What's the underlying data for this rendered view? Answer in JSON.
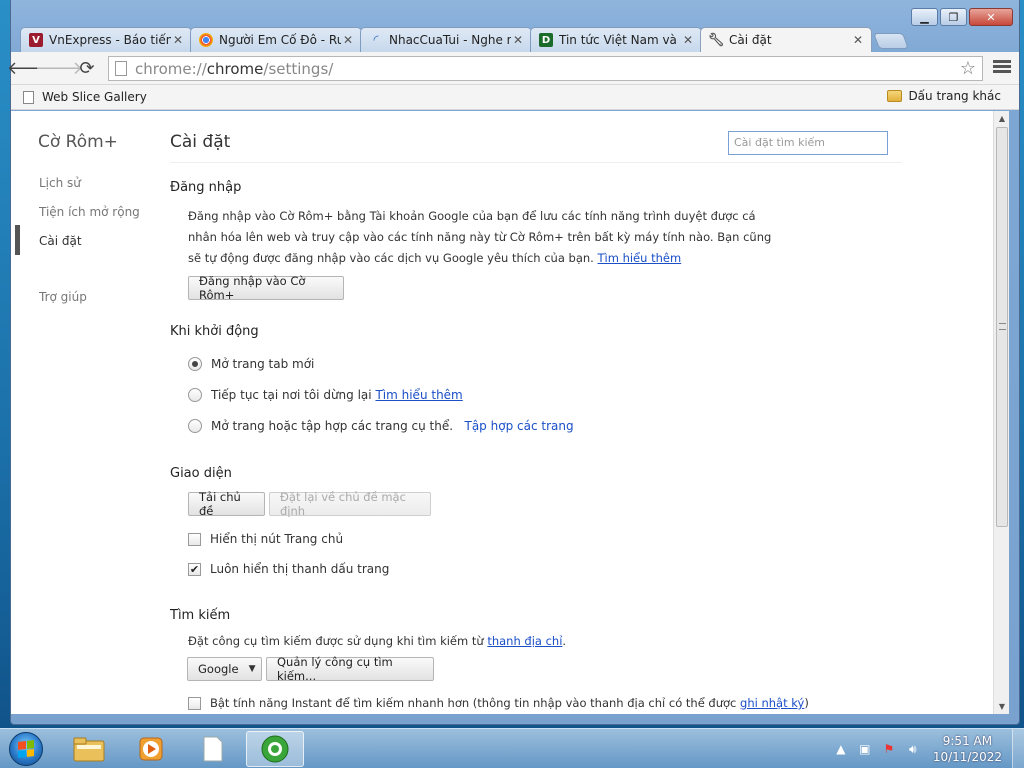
{
  "tabs": [
    {
      "title": "VnExpress - Báo tiếng Việt",
      "favicon_color": "#9b1c2e",
      "favicon_glyph": "V"
    },
    {
      "title": "Người Em Cố Đô - Rum",
      "favicon_color": "#4285f4",
      "favicon_glyph": "●"
    },
    {
      "title": "NhacCuaTui - Nghe nhạc",
      "favicon_color": "#2b6cc7",
      "favicon_glyph": "◜"
    },
    {
      "title": "Tin tức Việt Nam và quốc tế",
      "favicon_color": "#1b6b2a",
      "favicon_glyph": "D"
    },
    {
      "title": "Cài đặt",
      "favicon_color": "#555555",
      "favicon_glyph": "🔧"
    }
  ],
  "omnibox": {
    "scheme": "chrome://",
    "host": "chrome",
    "path": "/settings/"
  },
  "bookmarks": {
    "item": "Web Slice Gallery",
    "other": "Dấu trang khác"
  },
  "sidebar": {
    "brand": "Cờ Rôm+",
    "items": [
      "Lịch sử",
      "Tiện ích mở rộng",
      "Cài đặt",
      "Trợ giúp"
    ]
  },
  "page": {
    "title": "Cài đặt",
    "search_placeholder": "Cài đặt tìm kiếm"
  },
  "signin": {
    "heading": "Đăng nhập",
    "text": "Đăng nhập vào Cờ Rôm+ bằng Tài khoản Google của bạn để lưu các tính năng trình duyệt được cá nhân hóa lên web và truy cập vào các tính năng này từ Cờ Rôm+ trên bất kỳ máy tính nào. Bạn cũng sẽ tự động được đăng nhập vào các dịch vụ Google yêu thích của bạn.",
    "learn_more": "Tìm hiểu thêm",
    "button": "Đăng nhập vào Cờ Rôm+"
  },
  "startup": {
    "heading": "Khi khởi động",
    "opt1": "Mở trang tab mới",
    "opt2": "Tiếp tục tại nơi tôi dừng lại",
    "opt2_link": "Tìm hiểu thêm",
    "opt3": "Mở trang hoặc tập hợp các trang cụ thể.",
    "opt3_link": "Tập hợp các trang",
    "selected": 1
  },
  "appearance": {
    "heading": "Giao diện",
    "btn_theme": "Tải chủ đề",
    "btn_reset": "Đặt lại về chủ đề mặc định",
    "chk_home": "Hiển thị nút Trang chủ",
    "chk_home_checked": false,
    "chk_bookmarks": "Luôn hiển thị thanh dấu trang",
    "chk_bookmarks_checked": true
  },
  "search": {
    "heading": "Tìm kiếm",
    "text": "Đặt công cụ tìm kiếm được sử dụng khi tìm kiếm từ",
    "text_link": "thanh địa chỉ",
    "engine": "Google",
    "manage": "Quản lý công cụ tìm kiếm...",
    "instant_prefix": "Bật tính năng Instant để tìm kiếm nhanh hơn (thông tin nhập vào thanh địa chỉ có thể được",
    "instant_link": "ghi nhật ký",
    "instant_suffix": ")"
  },
  "taskbar": {
    "time": "9:51 AM",
    "date": "10/11/2022"
  }
}
